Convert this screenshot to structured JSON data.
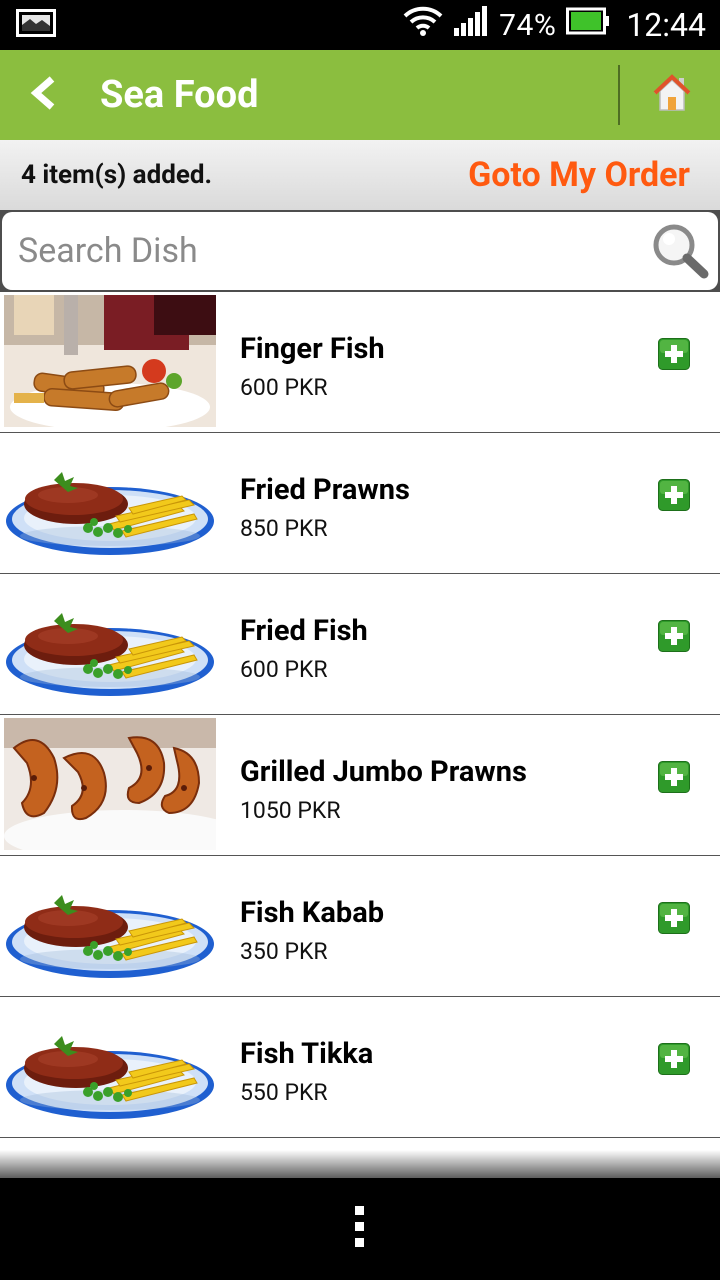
{
  "status_bar": {
    "battery_percent": "74%",
    "time": "12:44",
    "icons": [
      "image-notification-icon",
      "wifi-icon",
      "signal-icon",
      "battery-icon"
    ]
  },
  "header": {
    "title": "Sea Food",
    "icons": [
      "back-icon",
      "home-icon"
    ]
  },
  "order_bar": {
    "items_added": "4 item(s) added.",
    "goto_label": "Goto My Order"
  },
  "search": {
    "placeholder": "Search Dish",
    "value": ""
  },
  "colors": {
    "header_green": "#8bbe3f",
    "accent_orange": "#ff5a10",
    "add_green": "#2e9e2e"
  },
  "dishes": [
    {
      "name": "Finger Fish",
      "price": "600 PKR",
      "image": "photo-finger-fish"
    },
    {
      "name": "Fried Prawns",
      "price": "850 PKR",
      "image": "placeholder-plate"
    },
    {
      "name": "Fried Fish",
      "price": "600 PKR",
      "image": "placeholder-plate"
    },
    {
      "name": "Grilled Jumbo Prawns",
      "price": "1050 PKR",
      "image": "photo-prawns"
    },
    {
      "name": "Fish Kabab",
      "price": "350 PKR",
      "image": "placeholder-plate"
    },
    {
      "name": "Fish Tikka",
      "price": "550 PKR",
      "image": "placeholder-plate"
    }
  ]
}
